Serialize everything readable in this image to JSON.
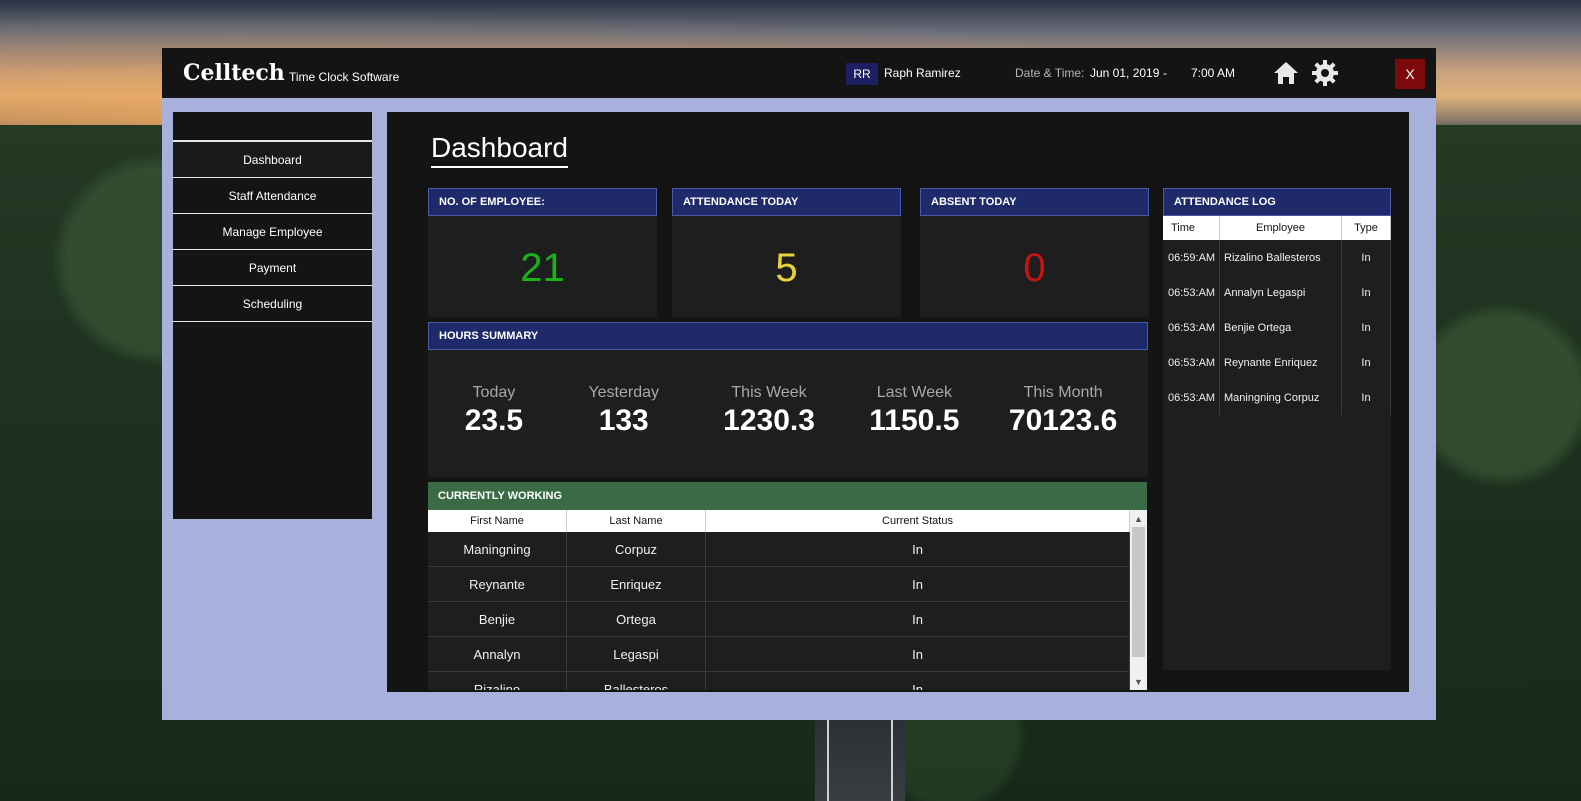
{
  "window": {
    "brand": "Celltech",
    "subtitle": "Time Clock Software",
    "user_initials": "RR",
    "user_name": "Raph Ramirez",
    "datetime_label": "Date & Time:",
    "date": "Jun 01, 2019",
    "separator": "-",
    "time": "7:00 AM",
    "close_label": "X"
  },
  "sidebar": {
    "items": [
      {
        "label": "Dashboard"
      },
      {
        "label": "Staff Attendance"
      },
      {
        "label": "Manage Employee"
      },
      {
        "label": "Payment"
      },
      {
        "label": "Scheduling"
      }
    ]
  },
  "main": {
    "title": "Dashboard",
    "cards": [
      {
        "header": "NO. OF EMPLOYEE:",
        "value": "21",
        "color": "#19b219"
      },
      {
        "header": "ATTENDANCE TODAY",
        "value": "5",
        "color": "#e8d33a"
      },
      {
        "header": "ABSENT TODAY",
        "value": "0",
        "color": "#c41414"
      }
    ],
    "hours_summary": {
      "header": "HOURS SUMMARY",
      "items": [
        {
          "label": "Today",
          "value": "23.5"
        },
        {
          "label": "Yesterday",
          "value": "133"
        },
        {
          "label": "This Week",
          "value": "1230.3"
        },
        {
          "label": "Last Week",
          "value": "1150.5"
        },
        {
          "label": "This Month",
          "value": "70123.6"
        }
      ]
    },
    "currently_working": {
      "header": "CURRENTLY WORKING",
      "columns": [
        "First Name",
        "Last Name",
        "Current Status"
      ],
      "rows": [
        [
          "Maningning",
          "Corpuz",
          "In"
        ],
        [
          "Reynante",
          "Enriquez",
          "In"
        ],
        [
          "Benjie",
          "Ortega",
          "In"
        ],
        [
          "Annalyn",
          "Legaspi",
          "In"
        ],
        [
          "Rizalino",
          "Ballesteros",
          "In"
        ]
      ]
    },
    "attendance_log": {
      "header": "ATTENDANCE LOG",
      "columns": [
        "Time",
        "Employee",
        "Type"
      ],
      "rows": [
        [
          "06:59:AM",
          "Rizalino Ballesteros",
          "In"
        ],
        [
          "06:53:AM",
          "Annalyn Legaspi",
          "In"
        ],
        [
          "06:53:AM",
          "Benjie Ortega",
          "In"
        ],
        [
          "06:53:AM",
          "Reynante Enriquez",
          "In"
        ],
        [
          "06:53:AM",
          "Maningning Corpuz",
          "In"
        ]
      ]
    }
  },
  "icons": {
    "home": "home-icon",
    "settings": "gear-icon"
  }
}
